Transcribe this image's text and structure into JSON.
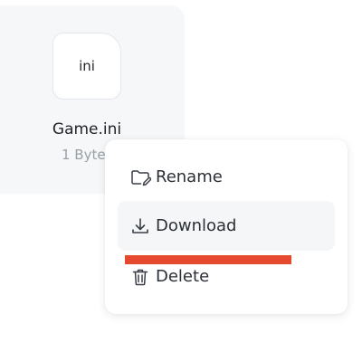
{
  "file": {
    "icon_label": "ini",
    "name": "Game.ini",
    "size": "1 Byte"
  },
  "context_menu": {
    "items": [
      {
        "label": "Rename",
        "icon": "folder-edit-icon"
      },
      {
        "label": "Download",
        "icon": "download-icon",
        "highlighted": true
      },
      {
        "label": "Delete",
        "icon": "trash-icon"
      }
    ]
  },
  "colors": {
    "card_bg": "#f6f7f9",
    "menu_hover_bg": "#f5f6f8",
    "annotation_red": "#e64a2e",
    "text": "#2b2f36",
    "muted_text": "#9aa0a8"
  }
}
